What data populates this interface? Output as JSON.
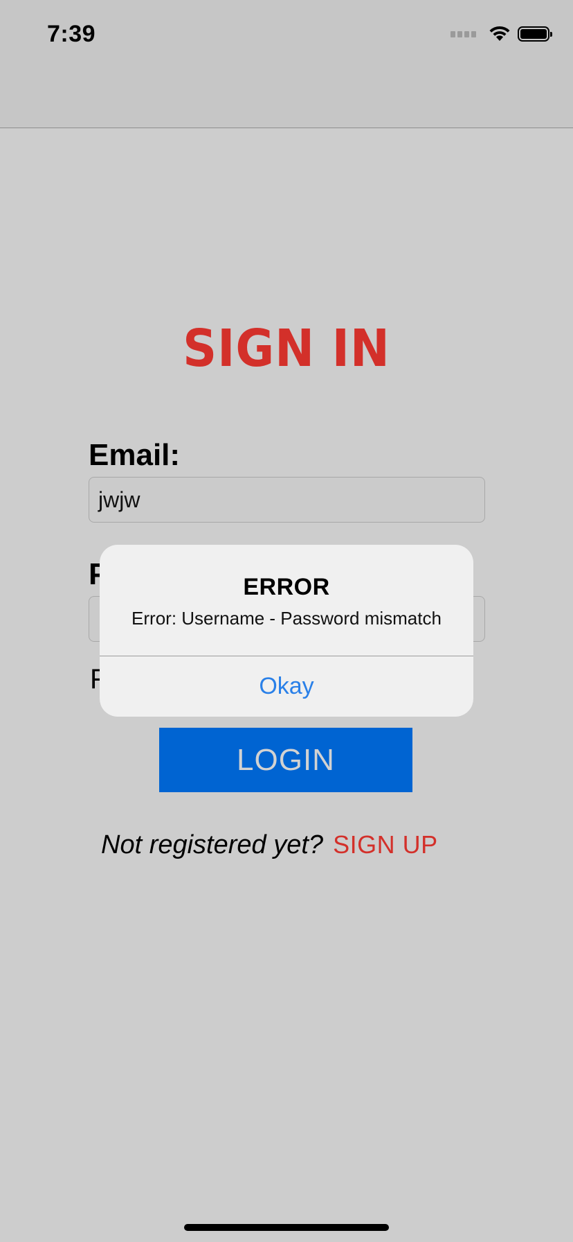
{
  "status_bar": {
    "time": "7:39",
    "icons": [
      "cellular-signal-icon",
      "wifi-icon",
      "battery-icon"
    ]
  },
  "screen": {
    "title": "SIGN IN",
    "email": {
      "label": "Email:",
      "value": "jwjw"
    },
    "password": {
      "label_visible": "P"
    },
    "remember_visible": "F",
    "login_button": "LOGIN",
    "register_prompt": "Not registered yet?",
    "signup_link": "SIGN UP"
  },
  "alert": {
    "title": "ERROR",
    "message": "Error: Username - Password mismatch",
    "button": "Okay"
  },
  "colors": {
    "accent_red": "#d3302a",
    "login_blue": "#0064d2",
    "alert_link_blue": "#2a80e8",
    "background": "#cdcdcd"
  }
}
